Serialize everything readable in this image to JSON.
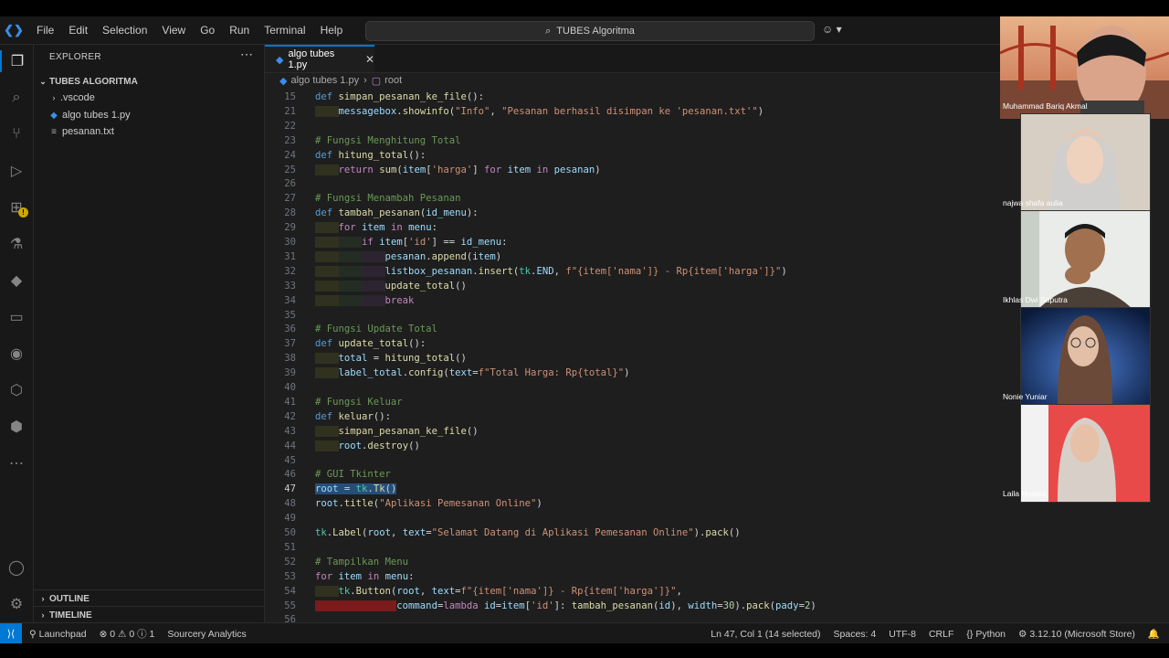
{
  "menu": [
    "File",
    "Edit",
    "Selection",
    "View",
    "Go",
    "Run",
    "Terminal",
    "Help"
  ],
  "command_center": "TUBES Algoritma",
  "explorer": {
    "title": "EXPLORER",
    "project": "TUBES ALGORITMA",
    "items": [
      ".vscode",
      "algo tubes 1.py",
      "pesanan.txt"
    ],
    "outline": "OUTLINE",
    "timeline": "TIMELINE"
  },
  "tab": {
    "label": "algo tubes 1.py"
  },
  "breadcrumb": {
    "file": "algo tubes 1.py",
    "symbol": "root"
  },
  "code_lines": [
    {
      "n": "15",
      "t": "def simpan_pesanan_ke_file():"
    },
    {
      "n": "21",
      "t": "    messagebox.showinfo(\"Info\", \"Pesanan berhasil disimpan ke 'pesanan.txt'\")"
    },
    {
      "n": "22",
      "t": ""
    },
    {
      "n": "23",
      "t": "# Fungsi Menghitung Total"
    },
    {
      "n": "24",
      "t": "def hitung_total():"
    },
    {
      "n": "25",
      "t": "    return sum(item['harga'] for item in pesanan)"
    },
    {
      "n": "26",
      "t": ""
    },
    {
      "n": "27",
      "t": "# Fungsi Menambah Pesanan"
    },
    {
      "n": "28",
      "t": "def tambah_pesanan(id_menu):"
    },
    {
      "n": "29",
      "t": "    for item in menu:"
    },
    {
      "n": "30",
      "t": "        if item['id'] == id_menu:"
    },
    {
      "n": "31",
      "t": "            pesanan.append(item)"
    },
    {
      "n": "32",
      "t": "            listbox_pesanan.insert(tk.END, f\"{item['nama']} - Rp{item['harga']}\")"
    },
    {
      "n": "33",
      "t": "            update_total()"
    },
    {
      "n": "34",
      "t": "            break"
    },
    {
      "n": "35",
      "t": ""
    },
    {
      "n": "36",
      "t": "# Fungsi Update Total"
    },
    {
      "n": "37",
      "t": "def update_total():"
    },
    {
      "n": "38",
      "t": "    total = hitung_total()"
    },
    {
      "n": "39",
      "t": "    label_total.config(text=f\"Total Harga: Rp{total}\")"
    },
    {
      "n": "40",
      "t": ""
    },
    {
      "n": "41",
      "t": "# Fungsi Keluar"
    },
    {
      "n": "42",
      "t": "def keluar():"
    },
    {
      "n": "43",
      "t": "    simpan_pesanan_ke_file()"
    },
    {
      "n": "44",
      "t": "    root.destroy()"
    },
    {
      "n": "45",
      "t": ""
    },
    {
      "n": "46",
      "t": "# GUI Tkinter"
    },
    {
      "n": "47",
      "t": "root = tk.Tk()"
    },
    {
      "n": "48",
      "t": "root.title(\"Aplikasi Pemesanan Online\")"
    },
    {
      "n": "49",
      "t": ""
    },
    {
      "n": "50",
      "t": "tk.Label(root, text=\"Selamat Datang di Aplikasi Pemesanan Online\").pack()"
    },
    {
      "n": "51",
      "t": ""
    },
    {
      "n": "52",
      "t": "# Tampilkan Menu"
    },
    {
      "n": "53",
      "t": "for item in menu:"
    },
    {
      "n": "54",
      "t": "    tk.Button(root, text=f\"{item['nama']} - Rp{item['harga']}\","
    },
    {
      "n": "55",
      "t": "              command=lambda id=item['id']: tambah_pesanan(id), width=30).pack(pady=2)"
    },
    {
      "n": "56",
      "t": ""
    }
  ],
  "current_line": "47",
  "participants": [
    "Muhammad Bariq Akmal",
    "najwa shafa aulia",
    "Ikhlas Dwi Saputra",
    "Nonie Yuniar",
    "Laila Husnia"
  ],
  "status": {
    "launchpad": "Launchpad",
    "problems": "⊗ 0 ⚠ 0 ⓘ 1",
    "sourcery": "Sourcery Analytics",
    "position": "Ln 47, Col 1 (14 selected)",
    "spaces": "Spaces: 4",
    "encoding": "UTF-8",
    "eol": "CRLF",
    "language": "Python",
    "interpreter": "3.12.10 (Microsoft Store)"
  },
  "colors": {
    "accent": "#0078d4",
    "error_line": "#7a1c1c",
    "selection": "#264f78"
  }
}
